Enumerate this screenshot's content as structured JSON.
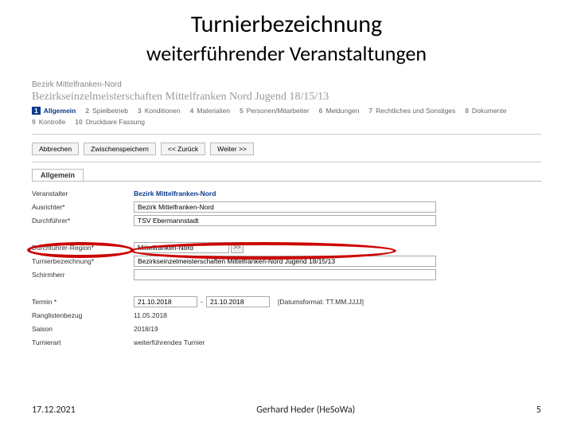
{
  "title": {
    "line1": "Turnierbezeichnung",
    "line2": "weiterführender Veranstaltungen"
  },
  "crumb": "Bezirk Mittelfranken-Nord",
  "pagehead": "Bezirkseinzelmeisterschaften Mittelfranken Nord Jugend 18/15/13",
  "tabs": {
    "row1": [
      {
        "n": "1",
        "t": "Allgemein"
      },
      {
        "n": "2",
        "t": "Spielbetrieb"
      },
      {
        "n": "3",
        "t": "Konditionen"
      },
      {
        "n": "4",
        "t": "Materialien"
      },
      {
        "n": "5",
        "t": "Personen/Mitarbeiter"
      },
      {
        "n": "6",
        "t": "Meldungen"
      },
      {
        "n": "7",
        "t": "Rechtliches und Sonstiges"
      },
      {
        "n": "8",
        "t": "Dokumente"
      }
    ],
    "row2": [
      {
        "n": "9",
        "t": "Kontrolle"
      },
      {
        "n": "10",
        "t": "Druckbare Fassung"
      }
    ]
  },
  "buttons": {
    "cancel": "Abbrechen",
    "saveInterim": "Zwischenspeichern",
    "back": "<< Zurück",
    "next": "Weiter >>"
  },
  "section": "Allgemein",
  "form": {
    "veranstalter_lbl": "Veranstalter",
    "veranstalter_val": "Bezirk Mittelfranken-Nord",
    "ausrichter_lbl": "Ausrichter*",
    "ausrichter_val": "Bezirk Mittelfranken-Nord",
    "durchfuehrer_lbl": "Durchführer*",
    "durchfuehrer_val": "TSV Ebermannstadt",
    "region_lbl": "Durchführer-Region*",
    "region_val": "Mittelfranken-Nord",
    "bez_lbl": "Turnierbezeichnung*",
    "bez_val": "Bezirkseinzelmeisterschaften Mittelfranken-Nord Jugend 18/15/13",
    "schirm_lbl": "Schirmherr",
    "termin_lbl": "Termin *",
    "termin_from": "21.10.2018",
    "termin_to": "21.10.2018",
    "termin_hint": "[Datumsformat: TT.MM.JJJJ]",
    "rang_lbl": "Ranglistenbezug",
    "rang_val": "11.05.2018",
    "saison_lbl": "Saison",
    "saison_val": "2018/19",
    "art_lbl": "Turnierart",
    "art_val": "weiterführendes Turnier"
  },
  "footer": {
    "date": "17.12.2021",
    "author": "Gerhard Heder (HeSoWa)",
    "page": "5"
  }
}
